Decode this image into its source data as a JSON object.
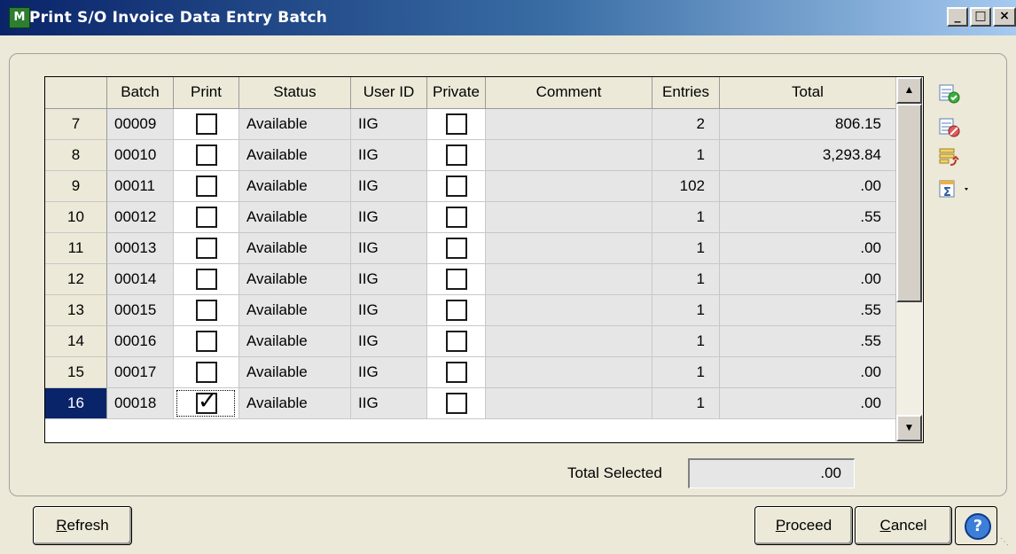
{
  "window": {
    "title": "Print S/O Invoice Data Entry Batch",
    "app_icon": "mas-app-icon",
    "app_icon_text": "M",
    "controls": {
      "minimize": "_",
      "maximize": "□",
      "close": "×"
    }
  },
  "grid": {
    "columns": [
      "",
      "Batch",
      "Print",
      "Status",
      "User ID",
      "Private",
      "Comment",
      "Entries",
      "Total"
    ],
    "rows": [
      {
        "num": "7",
        "batch": "00009",
        "print": false,
        "status": "Available",
        "user": "IIG",
        "private": false,
        "comment": "",
        "entries": "2",
        "total": "806.15"
      },
      {
        "num": "8",
        "batch": "00010",
        "print": false,
        "status": "Available",
        "user": "IIG",
        "private": false,
        "comment": "",
        "entries": "1",
        "total": "3,293.84"
      },
      {
        "num": "9",
        "batch": "00011",
        "print": false,
        "status": "Available",
        "user": "IIG",
        "private": false,
        "comment": "",
        "entries": "102",
        "total": ".00"
      },
      {
        "num": "10",
        "batch": "00012",
        "print": false,
        "status": "Available",
        "user": "IIG",
        "private": false,
        "comment": "",
        "entries": "1",
        "total": ".55"
      },
      {
        "num": "11",
        "batch": "00013",
        "print": false,
        "status": "Available",
        "user": "IIG",
        "private": false,
        "comment": "",
        "entries": "1",
        "total": ".00"
      },
      {
        "num": "12",
        "batch": "00014",
        "print": false,
        "status": "Available",
        "user": "IIG",
        "private": false,
        "comment": "",
        "entries": "1",
        "total": ".00"
      },
      {
        "num": "13",
        "batch": "00015",
        "print": false,
        "status": "Available",
        "user": "IIG",
        "private": false,
        "comment": "",
        "entries": "1",
        "total": ".55"
      },
      {
        "num": "14",
        "batch": "00016",
        "print": false,
        "status": "Available",
        "user": "IIG",
        "private": false,
        "comment": "",
        "entries": "1",
        "total": ".55"
      },
      {
        "num": "15",
        "batch": "00017",
        "print": false,
        "status": "Available",
        "user": "IIG",
        "private": false,
        "comment": "",
        "entries": "1",
        "total": ".00"
      },
      {
        "num": "16",
        "batch": "00018",
        "print": true,
        "status": "Available",
        "user": "IIG",
        "private": false,
        "comment": "",
        "entries": "1",
        "total": ".00",
        "selected": true
      }
    ]
  },
  "toolbar_icons": [
    "select-all-icon",
    "clear-all-icon",
    "batch-link-icon",
    "totals-dropdown-icon"
  ],
  "footer": {
    "total_selected_label": "Total Selected",
    "total_selected_value": ".00",
    "refresh_label": "Refresh",
    "proceed_label": "Proceed",
    "cancel_label": "Cancel",
    "help_glyph": "?"
  },
  "colors": {
    "title_gradient_start": "#0a246a",
    "selected_row_header": "#0a246a",
    "dialog_bg": "#ece9d8"
  }
}
